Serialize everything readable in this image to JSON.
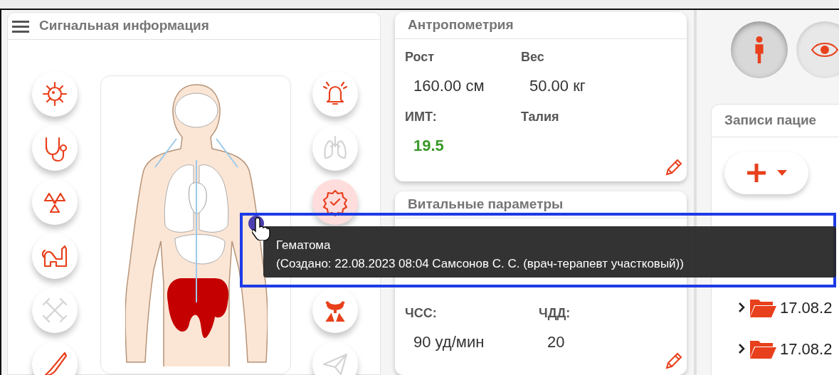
{
  "signal_panel": {
    "title": "Сигнальная информация",
    "left_buttons": [
      {
        "disabled": false
      },
      {
        "disabled": false
      },
      {
        "disabled": false
      },
      {
        "disabled": false
      },
      {
        "disabled": true
      },
      {
        "disabled": false
      }
    ],
    "right_buttons": [
      {
        "disabled": false,
        "selected": false
      },
      {
        "disabled": true,
        "selected": false
      },
      {
        "disabled": false,
        "selected": true
      },
      {
        "disabled": false,
        "selected": false
      },
      {
        "disabled": true,
        "selected": false
      }
    ],
    "tooltip": {
      "title": "Гематома",
      "detail": "(Создано: 22.08.2023 08:04 Самсонов С. С.  (врач-терапевт участковый))"
    }
  },
  "anthropometry": {
    "title": "Антропометрия",
    "fields": [
      {
        "label": "Рост",
        "value": "160.00 см"
      },
      {
        "label": "Вес",
        "value": "50.00 кг"
      },
      {
        "label": "ИМТ:",
        "value": "19.5",
        "color": "#3a9a2a"
      },
      {
        "label": "Талия"
      }
    ]
  },
  "vitals": {
    "title": "Витальные параметры",
    "fields": [
      {
        "label": "ЧСС:",
        "value": "90 уд/мин"
      },
      {
        "label": "ЧДД:",
        "value": "20"
      }
    ]
  },
  "view_buttons": [
    {
      "selected": true
    },
    {
      "selected": false
    }
  ],
  "records": {
    "title": "Записи пацие",
    "rows": [
      {
        "label": "17.08.2",
        "expanded": false
      },
      {
        "label": "17.08.2",
        "expanded": false
      }
    ]
  }
}
